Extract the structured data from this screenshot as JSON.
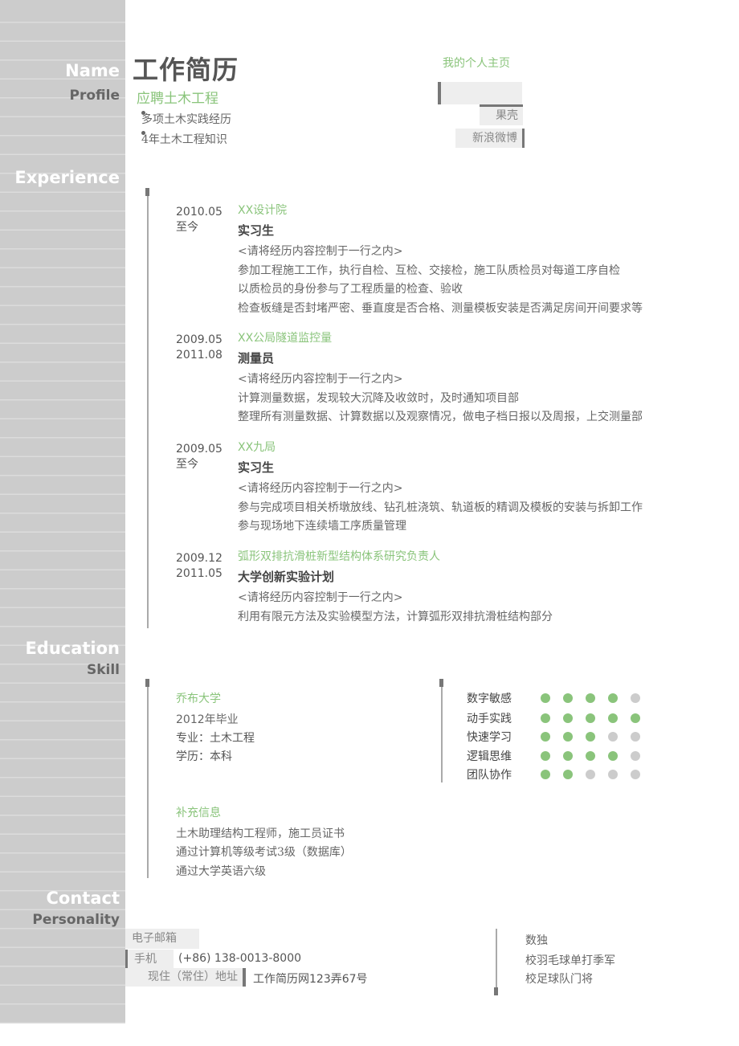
{
  "sidebar": {
    "name": "Name",
    "profile": "Profile",
    "experience": "Experience",
    "education": "Education",
    "skill": "Skill",
    "contact": "Contact",
    "personality": "Personality"
  },
  "header": {
    "title": "工作简历",
    "subtitle": "应聘土木工程",
    "bullets": [
      "多项土木实践经历",
      "4年土木工程知识"
    ],
    "homepage_label": "我的个人主页",
    "links": [
      "果壳",
      "新浪微博"
    ]
  },
  "experience": [
    {
      "start": "2010.05",
      "end": "至今",
      "org": "XX设计院",
      "role": "实习生",
      "lines": [
        "<请将经历内容控制于一行之内>",
        "参加工程施工工作，执行自检、互检、交接检，施工队质检员对每道工序自检",
        "以质检员的身份参与了工程质量的检查、验收",
        "检查板缝是否封堵严密、垂直度是否合格、测量模板安装是否满足房间开间要求等"
      ]
    },
    {
      "start": "2009.05",
      "end": "2011.08",
      "org": "XX公局隧道监控量",
      "role": "测量员",
      "lines": [
        "<请将经历内容控制于一行之内>",
        "计算测量数据，发现较大沉降及收敛时，及时通知项目部",
        "整理所有测量数据、计算数据以及观察情况，做电子档日报以及周报，上交测量部"
      ]
    },
    {
      "start": "2009.05",
      "end": "至今",
      "org": "XX九局",
      "role": "实习生",
      "lines": [
        "<请将经历内容控制于一行之内>",
        "参与完成项目相关桥墩放线、钻孔桩浇筑、轨道板的精调及模板的安装与拆卸工作",
        "参与现场地下连续墙工序质量管理"
      ]
    },
    {
      "start": "2009.12",
      "end": "2011.05",
      "org": "弧形双排抗滑桩新型结构体系研究负责人",
      "role": "大学创新实验计划",
      "lines": [
        "<请将经历内容控制于一行之内>",
        "利用有限元方法及实验模型方法，计算弧形双排抗滑桩结构部分"
      ]
    }
  ],
  "education": {
    "school": "乔布大学",
    "graduation": "2012年毕业",
    "major": "专业：土木工程",
    "degree": "学历：本科",
    "extra_title": "补充信息",
    "extra_lines": [
      "土木助理结构工程师，施工员证书",
      "通过计算机等级考试3级（数据库）",
      "通过大学英语六级"
    ]
  },
  "skills": [
    {
      "name": "数字敏感",
      "level": 4,
      "max": 5
    },
    {
      "name": "动手实践",
      "level": 5,
      "max": 5
    },
    {
      "name": "快速学习",
      "level": 3,
      "max": 5
    },
    {
      "name": "逻辑思维",
      "level": 4,
      "max": 5
    },
    {
      "name": "团队协作",
      "level": 2,
      "max": 5
    }
  ],
  "colors": {
    "accent": "#8ac47b",
    "dot_off": "#cccccc",
    "sidebar": "#cccccc"
  },
  "contact": {
    "email_label": "电子邮箱",
    "email_value": "",
    "phone_label": "手机",
    "phone_value": "(+86) 138-0013-8000",
    "address_label": "现住（常住）地址",
    "address_value": "工作简历网123弄67号"
  },
  "personality": [
    "数独",
    "校羽毛球单打季军",
    "校足球队门将"
  ]
}
